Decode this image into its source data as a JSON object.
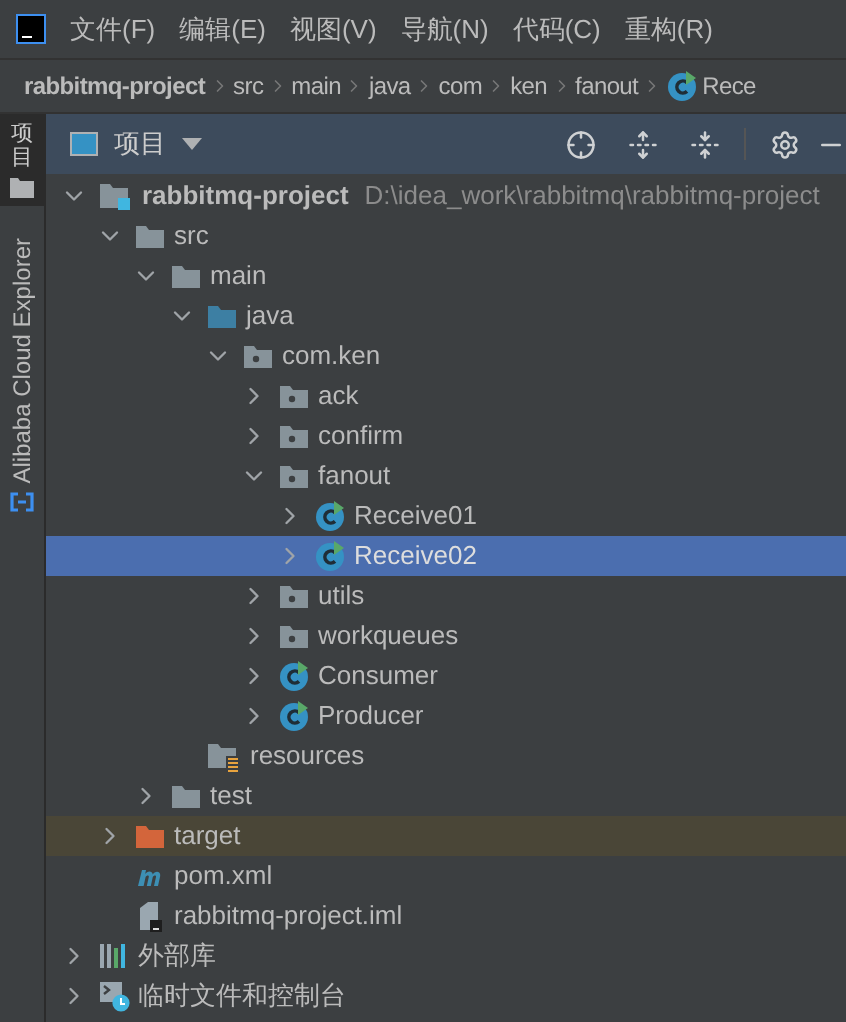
{
  "menu_bar": [
    "文件(F)",
    "编辑(E)",
    "视图(V)",
    "导航(N)",
    "代码(C)",
    "重构(R)"
  ],
  "breadcrumbs": [
    {
      "label": "rabbitmq-project",
      "kind": "project"
    },
    {
      "label": "src",
      "kind": "folder"
    },
    {
      "label": "main",
      "kind": "folder"
    },
    {
      "label": "java",
      "kind": "folder"
    },
    {
      "label": "com",
      "kind": "folder"
    },
    {
      "label": "ken",
      "kind": "folder"
    },
    {
      "label": "fanout",
      "kind": "folder"
    },
    {
      "label": "Rece",
      "kind": "class"
    }
  ],
  "left_stripe": [
    {
      "label": "项目",
      "kind": "project",
      "selected": true
    },
    {
      "label": "Alibaba Cloud Explorer",
      "kind": "cloud",
      "selected": false
    }
  ],
  "panel": {
    "title": "项目"
  },
  "tree": [
    {
      "label": "rabbitmq-project",
      "path": "D:\\idea_work\\rabbitmq\\rabbitmq-project",
      "kind": "module",
      "expanded": true,
      "selected": false,
      "children": [
        {
          "label": "src",
          "kind": "folder",
          "expanded": true,
          "selected": false,
          "children": [
            {
              "label": "main",
              "kind": "folder",
              "expanded": true,
              "selected": false,
              "children": [
                {
                  "label": "java",
                  "kind": "source",
                  "expanded": true,
                  "selected": false,
                  "children": [
                    {
                      "label": "com.ken",
                      "kind": "package",
                      "expanded": true,
                      "selected": false,
                      "children": [
                        {
                          "label": "ack",
                          "kind": "package",
                          "expanded": false,
                          "selected": false
                        },
                        {
                          "label": "confirm",
                          "kind": "package",
                          "expanded": false,
                          "selected": false
                        },
                        {
                          "label": "fanout",
                          "kind": "package",
                          "expanded": true,
                          "selected": false,
                          "children": [
                            {
                              "label": "Receive01",
                              "kind": "class",
                              "expanded": false,
                              "selected": false
                            },
                            {
                              "label": "Receive02",
                              "kind": "class",
                              "expanded": false,
                              "selected": true
                            }
                          ]
                        },
                        {
                          "label": "utils",
                          "kind": "package",
                          "expanded": false,
                          "selected": false
                        },
                        {
                          "label": "workqueues",
                          "kind": "package",
                          "expanded": false,
                          "selected": false
                        },
                        {
                          "label": "Consumer",
                          "kind": "class",
                          "expanded": false,
                          "selected": false
                        },
                        {
                          "label": "Producer",
                          "kind": "class",
                          "expanded": false,
                          "selected": false
                        }
                      ]
                    }
                  ]
                },
                {
                  "label": "resources",
                  "kind": "resources",
                  "selected": false
                }
              ]
            },
            {
              "label": "test",
              "kind": "folder",
              "expanded": false,
              "selected": false
            }
          ]
        },
        {
          "label": "target",
          "kind": "excluded",
          "expanded": false,
          "selected": false,
          "highlighted": true
        },
        {
          "label": "pom.xml",
          "kind": "maven",
          "selected": false
        },
        {
          "label": "rabbitmq-project.iml",
          "kind": "iml",
          "selected": false
        }
      ]
    },
    {
      "label": "外部库",
      "kind": "library",
      "expanded": false,
      "selected": false
    },
    {
      "label": "临时文件和控制台",
      "kind": "scratches",
      "expanded": false,
      "selected": false
    }
  ]
}
